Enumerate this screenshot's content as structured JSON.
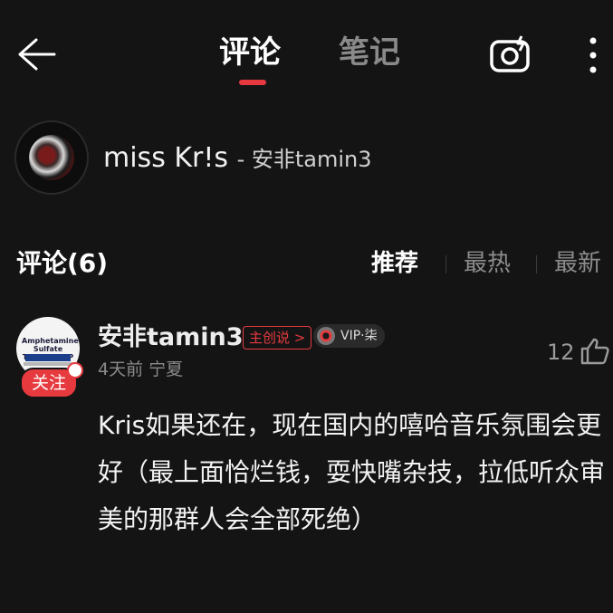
{
  "header": {
    "tabs": [
      {
        "label": "评论",
        "active": true
      },
      {
        "label": "笔记",
        "active": false
      }
    ],
    "accent_color": "#e5393f",
    "icons": [
      "back-arrow-icon",
      "camera-icon",
      "more-vertical-icon"
    ]
  },
  "song": {
    "title": "miss Kr!s",
    "artist": "- 安非tamin3"
  },
  "comments": {
    "header": "评论(6)",
    "sort_options": [
      "推荐",
      "最热",
      "最新"
    ],
    "active_sort": "推荐"
  },
  "comment": {
    "username": "安非tamin3",
    "creator_badge": "主创说 >",
    "vip_badge": "VIP·柒",
    "follow_label": "关注",
    "time": "4天前",
    "location": "宁夏",
    "likes": "12",
    "avatar_text": "Amphetamine Sulfate Tablets, USP 10 mg",
    "text": "Kris如果还在，现在国内的嘻哈音乐氛围会更好（最上面恰烂钱，耍快嘴杂技，拉低听众审美的那群人会全部死绝）"
  }
}
